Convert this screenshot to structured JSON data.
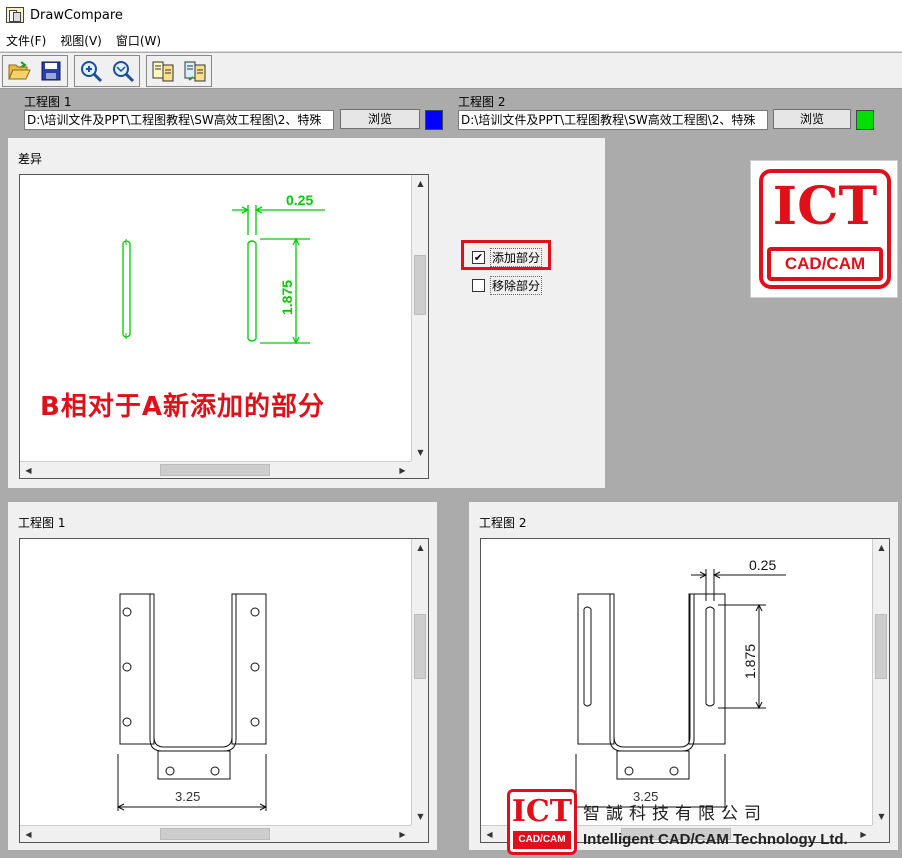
{
  "window": {
    "title": "DrawCompare"
  },
  "menu": {
    "file": "文件(F)",
    "view": "视图(V)",
    "window": "窗口(W)"
  },
  "toolbar": {
    "icons": [
      "open-folder-icon",
      "save-icon",
      "zoom-in-icon",
      "zoom-fit-icon",
      "compare-icon",
      "compare-swap-icon"
    ]
  },
  "drawing1": {
    "label": "工程图 1",
    "path": "D:\\培训文件及PPT\\工程图教程\\SW高效工程图\\2、特殊",
    "browse_label": "浏览",
    "color": "#0000ff"
  },
  "drawing2": {
    "label": "工程图 2",
    "path": "D:\\培训文件及PPT\\工程图教程\\SW高效工程图\\2、特殊",
    "browse_label": "浏览",
    "color": "#00e000"
  },
  "diff_panel": {
    "title": "差异",
    "dim_horizontal": "0.25",
    "dim_vertical": "1.875",
    "annotation": "B相对于A新添加的部分",
    "added_checkbox": {
      "label": "添加部分",
      "checked": true
    },
    "removed_checkbox": {
      "label": "移除部分",
      "checked": false
    }
  },
  "view1": {
    "title": "工程图 1",
    "dim_width": "3.25"
  },
  "view2": {
    "title": "工程图 2",
    "dim_horizontal": "0.25",
    "dim_vertical": "1.875",
    "dim_width": "3.25"
  },
  "logo": {
    "ict": "ICT",
    "cadcam": "CAD/CAM"
  },
  "footer": {
    "ict": "ICT",
    "cadcam": "CAD/CAM",
    "company_cn": "智誠科技有限公司",
    "company_en": "Intelligent CAD/CAM Technology Ltd."
  },
  "colors": {
    "accent_red": "#e0101a",
    "diff_green": "#00cc00"
  }
}
